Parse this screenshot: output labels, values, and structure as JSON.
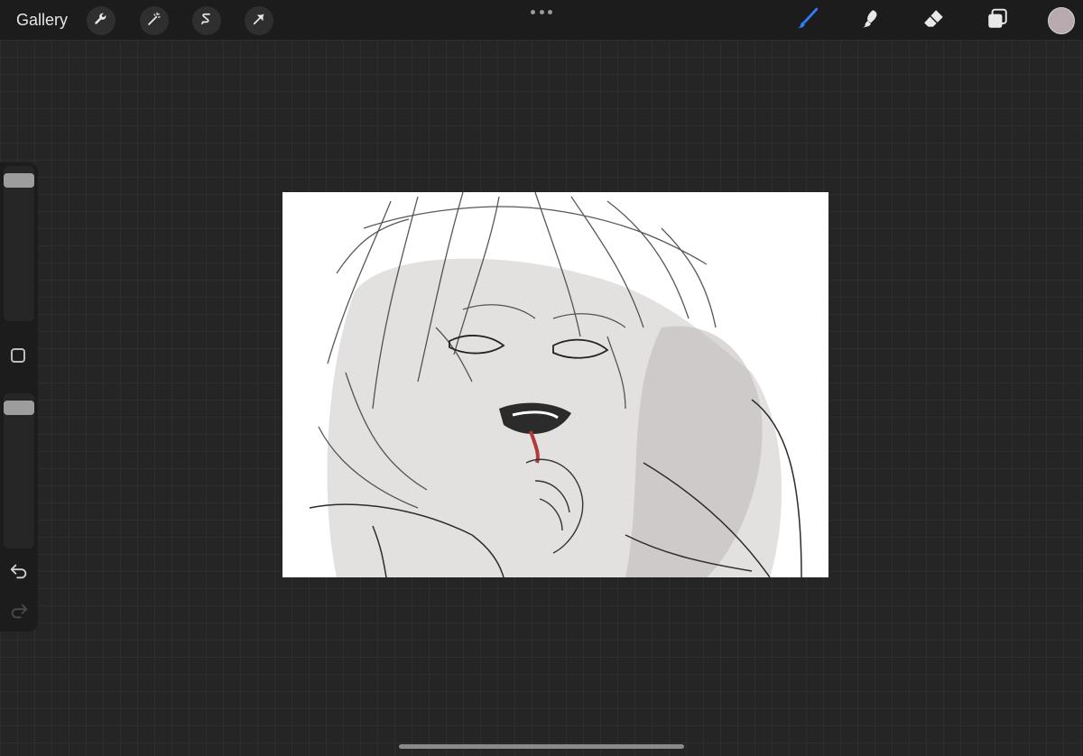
{
  "app": {
    "gallery_label": "Gallery"
  },
  "top_tools_left": [
    {
      "icon": "wrench-icon"
    },
    {
      "icon": "magic-wand-icon"
    },
    {
      "icon": "selection-icon"
    },
    {
      "icon": "transform-arrow-icon"
    }
  ],
  "top_tools_right": [
    {
      "icon": "brush-icon",
      "active": true
    },
    {
      "icon": "smudge-icon"
    },
    {
      "icon": "eraser-icon"
    },
    {
      "icon": "layers-icon"
    }
  ],
  "current_color": "#b9aab0",
  "accent_color": "#2f7cf6",
  "sidebar": {
    "brush_size_level": 0.95,
    "opacity_level": 0.95
  }
}
